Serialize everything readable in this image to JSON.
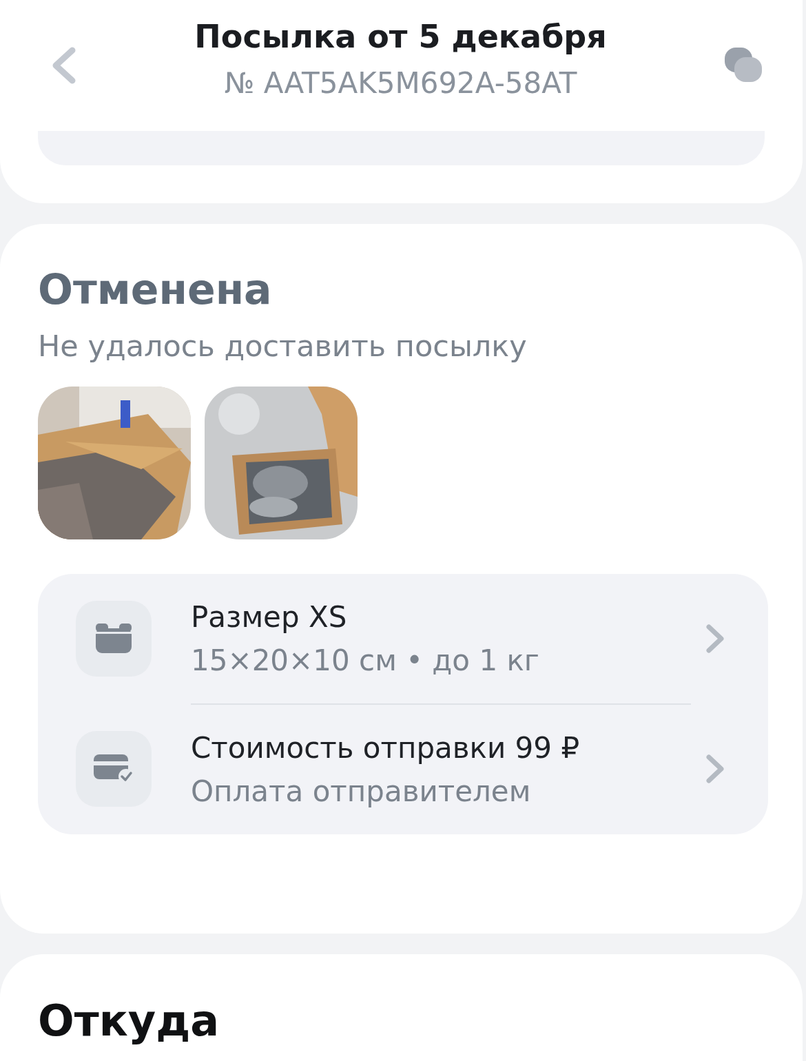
{
  "header": {
    "title": "Посылка от 5 декабря",
    "subtitle": "№ AAT5AK5M692A-58AT"
  },
  "status": {
    "title": "Отменена",
    "description": "Не удалось доставить посылку"
  },
  "details": [
    {
      "kind": "size",
      "title": "Размер XS",
      "subtitle": "15×20×10 см • до 1 кг"
    },
    {
      "kind": "payment",
      "title": "Стоимость отправки 99 ₽",
      "subtitle": "Оплата отправителем"
    }
  ],
  "next_section": {
    "title": "Откуда"
  }
}
